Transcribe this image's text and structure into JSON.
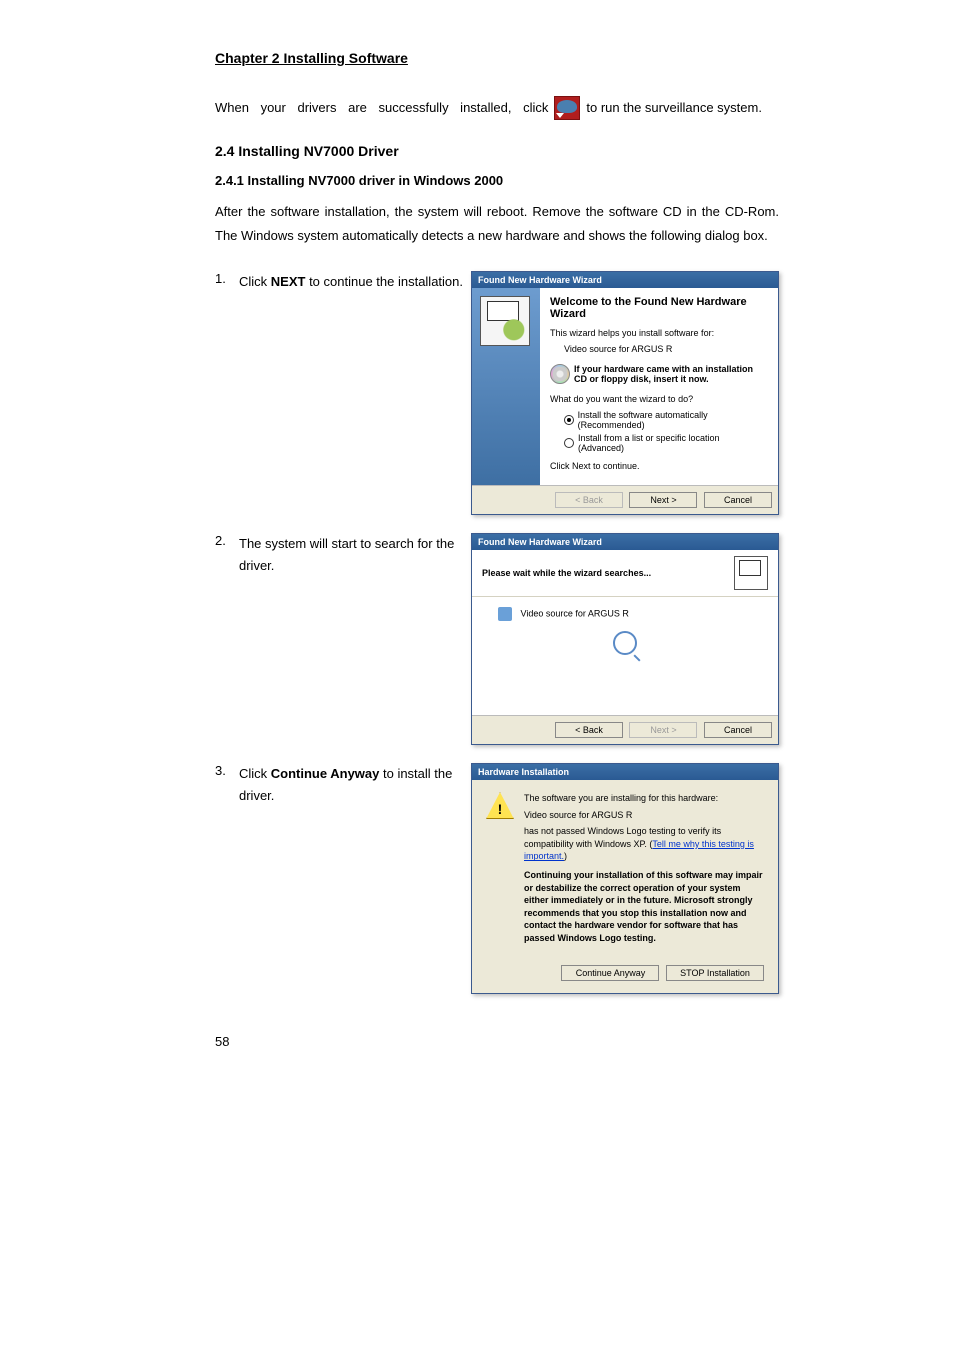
{
  "header": {
    "chapter": "Chapter 2 Installing Software"
  },
  "intro": {
    "pre": "When your drivers are successfully installed, click",
    "post": "to run the surveillance system."
  },
  "sec": {
    "num_title": "2.4   Installing NV7000 Driver",
    "sub_num_title": "2.4.1   Installing NV7000 driver in Windows 2000",
    "lead": "After the software installation, the system will reboot. Remove the software CD in the CD-Rom. The Windows system automatically detects a new hardware and shows the following dialog box."
  },
  "steps": {
    "s1": {
      "num": "1.",
      "pre": "Click ",
      "bold": "NEXT",
      "post": " to continue the installation."
    },
    "s2": {
      "num": "2.",
      "text": "The system will start to search for the driver."
    },
    "s3": {
      "num": "3.",
      "pre": "Click ",
      "bold": "Continue Anyway",
      "post": " to install the driver."
    }
  },
  "dlg1": {
    "title": "Found New Hardware Wizard",
    "h1": "Welcome to the Found New Hardware Wizard",
    "p1": "This wizard helps you install software for:",
    "device": "Video source for ARGUS R",
    "cd_note": "If your hardware came with an installation CD or floppy disk, insert it now.",
    "q": "What do you want the wizard to do?",
    "opt1": "Install the software automatically (Recommended)",
    "opt2": "Install from a list or specific location (Advanced)",
    "cont": "Click Next to continue.",
    "btn_back": "< Back",
    "btn_next": "Next >",
    "btn_cancel": "Cancel"
  },
  "dlg2": {
    "title": "Found New Hardware Wizard",
    "top": "Please wait while the wizard searches...",
    "device": "Video source for ARGUS R",
    "btn_back": "< Back",
    "btn_next": "Next >",
    "btn_cancel": "Cancel"
  },
  "dlg3": {
    "title": "Hardware Installation",
    "l1": "The software you are installing for this hardware:",
    "device": "Video source for ARGUS R",
    "l2a": "has not passed Windows Logo testing to verify its compatibility with Windows XP. (",
    "l2link": "Tell me why this testing is important.",
    "l2b": ")",
    "warn": "Continuing your installation of this software may impair or destabilize the correct operation of your system either immediately or in the future. Microsoft strongly recommends that you stop this installation now and contact the hardware vendor for software that has passed Windows Logo testing.",
    "btn_continue": "Continue Anyway",
    "btn_stop": "STOP Installation"
  },
  "page_number": "58"
}
